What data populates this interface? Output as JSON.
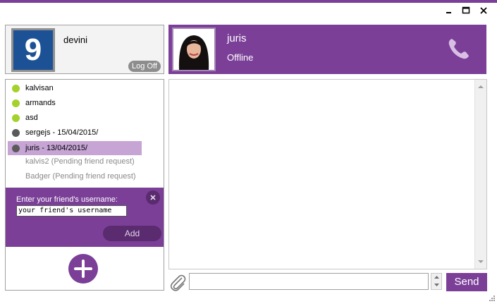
{
  "window": {
    "minimize_icon": "minimize-icon",
    "maximize_icon": "maximize-icon",
    "close_icon": "close-icon",
    "accent_color": "#7b3f98"
  },
  "user": {
    "avatar_text": "9",
    "name": "devini",
    "logoff_label": "Log Off"
  },
  "contact": {
    "name": "juris",
    "status": "Offline",
    "call_icon": "phone-icon"
  },
  "friends": [
    {
      "label": "kalvisan",
      "status": "online"
    },
    {
      "label": "armands",
      "status": "online"
    },
    {
      "label": "asd",
      "status": "online"
    },
    {
      "label": "sergejs - 15/04/2015/",
      "status": "offline"
    },
    {
      "label": "juris - 13/04/2015/",
      "status": "offline",
      "selected": true
    }
  ],
  "pending": [
    "kalvis2 (Pending friend request)",
    "Badger (Pending friend request)"
  ],
  "add_friend": {
    "label": "Enter your friend's username:",
    "value": "your friend's username",
    "add_label": "Add"
  },
  "composer": {
    "send_label": "Send",
    "attach_icon": "paperclip-icon"
  },
  "colors": {
    "online": "#a4d12c",
    "offline": "#5a5a5a",
    "selected_row": "#c6a5d5"
  }
}
